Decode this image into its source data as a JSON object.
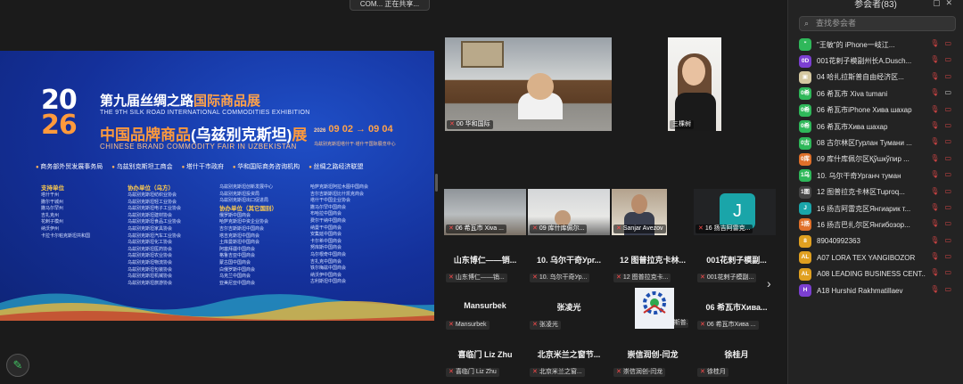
{
  "top_tooltip": "COM... 正在共享...",
  "share": {
    "year_top": "20",
    "year_top_accent": "26",
    "title_cn": "第九届丝绸之路",
    "title_cn_accent": "国际商品展",
    "title_en": "THE 9TH SILK ROAD INTERNATIONAL COMMODITIES EXHIBITION",
    "subtitle_cn": "中国品牌商品",
    "subtitle_cn_white": "(乌兹别克斯坦)",
    "subtitle_cn_end": "展",
    "subtitle_en": "CHINESE BRAND COMMODITY FAIR IN UZBEKISTAN",
    "date_text": "09 02 → 09 04",
    "date_year": "2026",
    "date_note": "乌兹别克斯坦塔什干·塔什干国际展览中心",
    "organizers": [
      "商务部外贸发展事务局",
      "乌兹别克斯坦工商会",
      "塔什干市政府",
      "华和国际商务咨询机构",
      "丝绸之路经济联盟"
    ],
    "col1_head": "支持单位",
    "col1": [
      "塔什干州",
      "撒尔干城州",
      "撒马尔罕州",
      "吉扎克州",
      "花剌子模州",
      "纳沃伊州",
      "卡拉卡尔帕克斯坦共和国"
    ],
    "col2_head": "协办单位（乌方）",
    "col2": [
      "乌兹别克斯坦纺织业协会",
      "乌兹别克斯坦轻工业协会",
      "乌兹别克斯坦电子工业协会",
      "乌兹别克斯坦建材协会",
      "乌兹别克斯坦食品工业协会",
      "乌兹别克斯坦家具协会",
      "乌兹别克斯坦汽车工业协会",
      "乌兹别克斯坦化工协会",
      "乌兹别克斯坦医药协会",
      "乌兹别克斯坦农业协会",
      "乌兹别克斯坦物流协会",
      "乌兹别克斯坦包装协会",
      "乌兹别克斯坦机械协会",
      "乌兹别克斯坦旅游协会"
    ],
    "col3_head": "协办单位（其它国别）",
    "col3a": [
      "乌兹别克斯坦创新发展中心",
      "乌兹别克斯坦投资局",
      "乌兹别克斯坦出口促进局"
    ],
    "col3": [
      "俄罗斯中国商会",
      "哈萨克斯坦中资企业协会",
      "吉尔吉斯斯坦中国商会",
      "塔吉克斯坦中国商会",
      "土库曼斯坦中国商会",
      "阿塞拜疆中国商会",
      "格鲁吉亚中国商会",
      "蒙古国中国商会",
      "白俄罗斯中国商会",
      "乌克兰中国商会",
      "亚美尼亚中国商会"
    ],
    "col4": [
      "哈萨克斯坦阿拉木图中国商会",
      "吉尔吉斯斯坦比什凯克商会",
      "塔什干中国企业协会",
      "撒马尔罕中国商会",
      "布哈拉中国商会",
      "费尔干纳中国商会",
      "纳曼干中国商会",
      "安集延中国商会",
      "卡尔希中国商会",
      "努库斯中国商会",
      "乌尔根奇中国商会",
      "吉扎克中国商会",
      "铁尔梅兹中国商会",
      "纳沃伊中国商会",
      "古利斯坦中国商会"
    ]
  },
  "videos": [
    {
      "label": "00 华和国际"
    },
    {
      "label": "三棵树"
    },
    {
      "label": "06 希瓦市 Xiva ..."
    },
    {
      "label": "09 库什库佩尔..."
    },
    {
      "label": "Sanjar Avezov"
    },
    {
      "label": "16 扬吉阿雷克..."
    },
    {
      "avatar": "J"
    }
  ],
  "name_tiles": [
    {
      "name": "山东博仁——销...",
      "label": "山东博仁——销..."
    },
    {
      "name": "10. 乌尔干奇Ург...",
      "label": "10. 乌尔干奇Ур..."
    },
    {
      "name": "12 图普拉克卡林...",
      "label": "12 图普拉克卡..."
    },
    {
      "name": "001花剌子模副...",
      "label": "001花剌子模副..."
    },
    {
      "name": "Mansurbek",
      "label": "Mansurbek"
    },
    {
      "name": "张凌光",
      "label": "张凌光"
    },
    {
      "name": "",
      "label": "04 哈扎拉斯普..."
    },
    {
      "name": "06 希瓦市Хива...",
      "label": "06 希瓦市Хива ..."
    },
    {
      "name": "喜临门 Liz Zhu",
      "label": "喜临门 Liz Zhu"
    },
    {
      "name": "北京米兰之窗节...",
      "label": "北京米兰之窗..."
    },
    {
      "name": "崇信润创-闫龙",
      "label": "崇信润创-闫龙"
    },
    {
      "name": "徐桂月",
      "label": "徐桂月"
    }
  ],
  "panel": {
    "title": "参会者(83)",
    "search_placeholder": "查找参会者",
    "participants": [
      {
        "av": "\"",
        "color": "#2fb85a",
        "name": "\"王敏\"的 iPhone一岐江..."
      },
      {
        "av": "0D",
        "color": "#7b3fd1",
        "name": "001花剌子模副州长A.Dusch..."
      },
      {
        "av": "▣",
        "color": "#d4c8a0",
        "name": "04 哈扎拉斯普自由经济区..."
      },
      {
        "av": "0希",
        "color": "#2fb85a",
        "name": "06 希瓦市 Xiva tumani"
      },
      {
        "av": "0希",
        "color": "#2fb85a",
        "name": "06 希瓦市iPhone Хива шахар"
      },
      {
        "av": "0希",
        "color": "#2fb85a",
        "name": "06 希瓦市Хива шахар"
      },
      {
        "av": "0古",
        "color": "#2fb85a",
        "name": "08 古尔林区Гурлан Тумани ..."
      },
      {
        "av": "0库",
        "color": "#e0702a",
        "name": "09 库什库佩尔区Қўшкўпир ..."
      },
      {
        "av": "1乌",
        "color": "#2fb85a",
        "name": "10. 乌尔干奇Урганч туман"
      },
      {
        "av": "1图",
        "color": "#444",
        "name": "12 图普拉克卡林区Tuproq..."
      },
      {
        "av": "J",
        "color": "#1aa5a9",
        "name": "16 扬吉阿雷克区Янгиарик т..."
      },
      {
        "av": "1扬",
        "color": "#e0702a",
        "name": "16 扬吉巴扎尔区Янгибозор..."
      },
      {
        "av": "8",
        "color": "#e0a020",
        "name": "89040992363"
      },
      {
        "av": "AL",
        "color": "#e0a020",
        "name": "A07 LORA TEX YANGIBOZOR"
      },
      {
        "av": "AL",
        "color": "#e0a020",
        "name": "A08 LEADING BUSINESS CENT..."
      },
      {
        "av": "H",
        "color": "#7b3fd1",
        "name": "A18 Hurshid Rakhmatillaev"
      }
    ]
  }
}
